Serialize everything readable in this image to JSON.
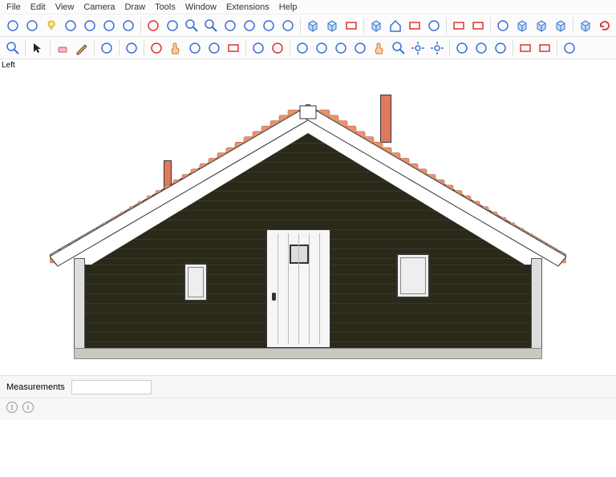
{
  "menu": {
    "items": [
      "File",
      "Edit",
      "View",
      "Camera",
      "Draw",
      "Tools",
      "Window",
      "Extensions",
      "Help"
    ]
  },
  "toolbars": {
    "row1": [
      "model-info",
      "iso",
      "lightbulb",
      "dimension",
      "text",
      "leader",
      "font",
      "sep",
      "axes-red",
      "ortho-blue",
      "zoom",
      "zoom-ext",
      "pivot",
      "orbit",
      "walk",
      "camera-eye",
      "sep",
      "solid",
      "xray",
      "plane",
      "sep",
      "gift",
      "home",
      "monitor",
      "cloud",
      "sep",
      "section",
      "section-fill",
      "sep",
      "globe",
      "box-blue",
      "box-teal",
      "xray-box",
      "sep",
      "cube",
      "refresh"
    ],
    "row2": [
      "zoom-window",
      "sep",
      "select",
      "sep",
      "eraser",
      "pencil",
      "sep",
      "line-tool",
      "sep",
      "arc",
      "sep",
      "orbit-red",
      "pan-red",
      "orbit-blue",
      "rotate",
      "rect",
      "sep",
      "tri-blue",
      "tri-red",
      "sep",
      "plugin1",
      "plugin2",
      "plugin3",
      "plugin4",
      "hand",
      "zoom2",
      "target",
      "gear",
      "sep",
      "earth",
      "layers",
      "scissors",
      "sep",
      "clip1",
      "clip2",
      "sep",
      "style"
    ]
  },
  "view": {
    "label": "Left"
  },
  "status": {
    "measurements_label": "Measurements",
    "measurements_value": ""
  }
}
